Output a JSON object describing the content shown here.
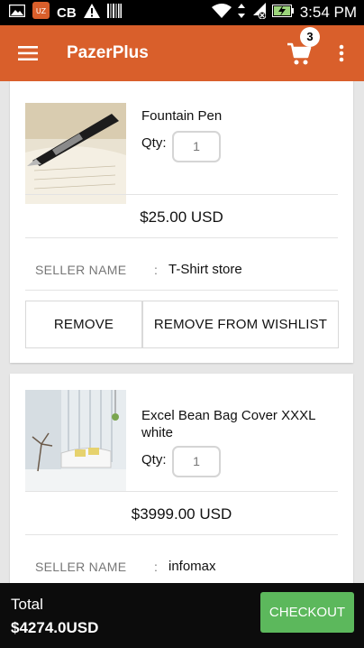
{
  "status_bar": {
    "time": "3:54 PM",
    "icons": [
      "image-icon",
      "app-notification-icon",
      "cb-icon",
      "warning-icon",
      "barcode-icon",
      "wifi-icon",
      "data-arrows-icon",
      "sim-no-signal-icon",
      "battery-charging-icon"
    ],
    "cb_text": "CB"
  },
  "app_bar": {
    "title": "PazerPlus",
    "cart_count": "3",
    "color": "#d95f2b"
  },
  "items": [
    {
      "name": "Fountain Pen",
      "qty_label": "Qty:",
      "qty": "1",
      "price": "$25.00 USD",
      "seller_label": "SELLER NAME",
      "seller_colon": ":",
      "seller": "T-Shirt store",
      "remove_label": "REMOVE",
      "wishlist_label": "REMOVE FROM WISHLIST"
    },
    {
      "name": "Excel Bean Bag Cover XXXL white",
      "qty_label": "Qty:",
      "qty": "1",
      "price": "$3999.00 USD",
      "seller_label": "SELLER NAME",
      "seller_colon": ":",
      "seller": "infomax"
    }
  ],
  "footer": {
    "total_label": "Total",
    "total_value": "$4274.0USD",
    "checkout_label": "CHECKOUT",
    "checkout_color": "#5cb85c"
  }
}
